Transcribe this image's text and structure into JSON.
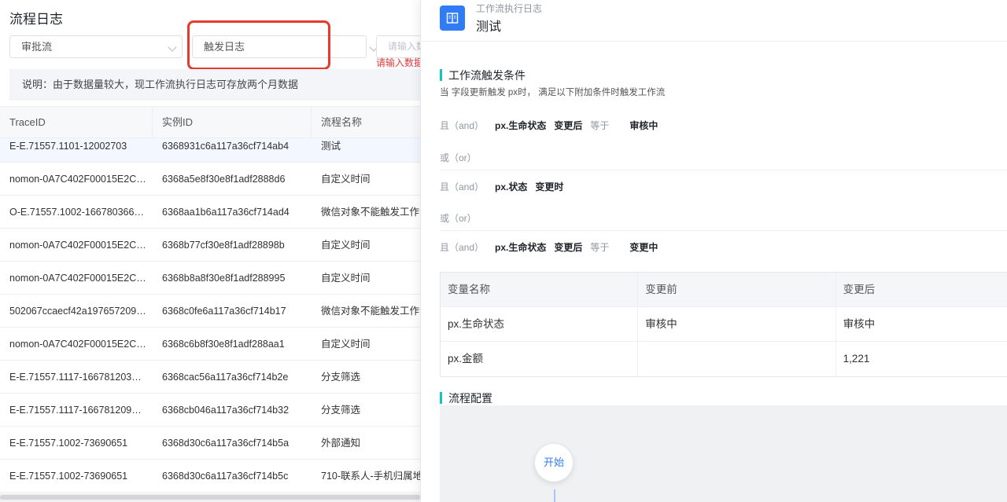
{
  "left": {
    "title": "流程日志",
    "filter1": "审批流",
    "filter2": "触发日志",
    "filter3_placeholder": "请输入数",
    "error_text": "请输入数据",
    "notice": "说明：由于数据量较大，现工作流执行日志可存放两个月数据",
    "columns": [
      "TraceID",
      "实例ID",
      "流程名称"
    ],
    "rows": [
      [
        "E-E.71557.1101-12002703",
        "6368931c6a117a36cf714ab4",
        "测试"
      ],
      [
        "nomon-0A7C402F00015E2C4...",
        "6368a5e8f30e8f1adf2888d6",
        "自定义时间"
      ],
      [
        "O-E.71557.1002-1667803660...",
        "6368aa1b6a117a36cf714ad4",
        "微信对象不能触发工作流"
      ],
      [
        "nomon-0A7C402F00015E2C4...",
        "6368b77cf30e8f1adf28898b",
        "自定义时间"
      ],
      [
        "nomon-0A7C402F00015E2C4...",
        "6368b8a8f30e8f1adf288995",
        "自定义时间"
      ],
      [
        "502067ccaecf42a1976572099...",
        "6368c0fe6a117a36cf714b17",
        "微信对象不能触发工作流"
      ],
      [
        "nomon-0A7C402F00015E2C4...",
        "6368c6b8f30e8f1adf288aa1",
        "自定义时间"
      ],
      [
        "E-E.71557.1117-16678120345...",
        "6368cac56a117a36cf714b2e",
        "分支筛选"
      ],
      [
        "E-E.71557.1117-16678120997...",
        "6368cb046a117a36cf714b32",
        "分支筛选"
      ],
      [
        "E-E.71557.1002-73690651",
        "6368d30c6a117a36cf714b5a",
        "外部通知"
      ],
      [
        "E-E.71557.1002-73690651",
        "6368d30c6a117a36cf714b5c",
        "710-联系人-手机归属地"
      ]
    ]
  },
  "drawer": {
    "subtitle": "工作流执行日志",
    "title": "测试",
    "section_trigger": "工作流触发条件",
    "trigger_desc": "当 字段更新触发 px时， 满足以下附加条件时触发工作流",
    "cond1": {
      "op": "且（and）",
      "field": "px.生命状态",
      "when": "变更后",
      "cmp": "等于",
      "value": "审核中"
    },
    "or1": "或（or）",
    "cond2": {
      "op": "且（and）",
      "field": "px.状态",
      "when": "变更时"
    },
    "or2": "或（or）",
    "cond3": {
      "op": "且（and）",
      "field": "px.生命状态",
      "when": "变更后",
      "cmp": "等于",
      "value": "变更中"
    },
    "var_table": {
      "headers": [
        "变量名称",
        "变更前",
        "变更后"
      ],
      "rows": [
        [
          "px.生命状态",
          "审核中",
          "审核中"
        ],
        [
          "px.金额",
          "",
          "1,221"
        ]
      ]
    },
    "section_config": "流程配置",
    "start_node": "开始"
  },
  "colors": {
    "accent": "#2f7cf6",
    "teal": "#13c2c2",
    "error": "#e4393c",
    "highlight": "#e8392f"
  }
}
